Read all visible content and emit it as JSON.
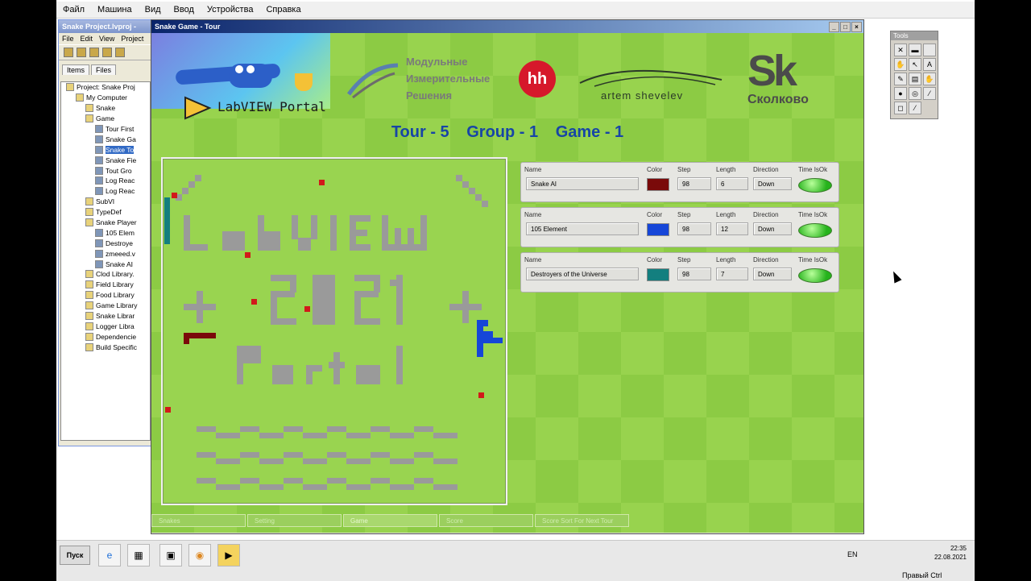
{
  "vm_menu": [
    "Файл",
    "Машина",
    "Вид",
    "Ввод",
    "Устройства",
    "Справка"
  ],
  "project": {
    "title": "Snake Project.lvproj -",
    "menu": [
      "File",
      "Edit",
      "View",
      "Project"
    ],
    "tabs": [
      "Items",
      "Files"
    ],
    "tree": [
      {
        "label": "Project: Snake Proj",
        "type": "folder",
        "indent": 0
      },
      {
        "label": "My Computer",
        "type": "folder",
        "indent": 1
      },
      {
        "label": "Snake",
        "type": "folder",
        "indent": 2
      },
      {
        "label": "Game",
        "type": "folder",
        "indent": 2
      },
      {
        "label": "Tour First",
        "type": "vi",
        "indent": 3
      },
      {
        "label": "Snake Ga",
        "type": "vi",
        "indent": 3
      },
      {
        "label": "Snake To",
        "type": "vi",
        "indent": 3,
        "selected": true
      },
      {
        "label": "Snake Fie",
        "type": "vi",
        "indent": 3
      },
      {
        "label": "Tout Gro",
        "type": "vi",
        "indent": 3
      },
      {
        "label": "Log Reac",
        "type": "vi",
        "indent": 3
      },
      {
        "label": "Log Reac",
        "type": "vi",
        "indent": 3
      },
      {
        "label": "SubVI",
        "type": "folder",
        "indent": 2
      },
      {
        "label": "TypeDef",
        "type": "folder",
        "indent": 2
      },
      {
        "label": "Snake Player",
        "type": "folder",
        "indent": 2
      },
      {
        "label": "105 Elem",
        "type": "vi",
        "indent": 3
      },
      {
        "label": "Destroye",
        "type": "vi",
        "indent": 3
      },
      {
        "label": "zmeeed.v",
        "type": "vi",
        "indent": 3
      },
      {
        "label": "Snake AI",
        "type": "vi",
        "indent": 3
      },
      {
        "label": "Clod Library.",
        "type": "folder",
        "indent": 2
      },
      {
        "label": "Field Library",
        "type": "folder",
        "indent": 2
      },
      {
        "label": "Food Library",
        "type": "folder",
        "indent": 2
      },
      {
        "label": "Game Library",
        "type": "folder",
        "indent": 2
      },
      {
        "label": "Snake Librar",
        "type": "folder",
        "indent": 2
      },
      {
        "label": "Logger Libra",
        "type": "folder",
        "indent": 2
      },
      {
        "label": "Dependencie",
        "type": "folder",
        "indent": 2
      },
      {
        "label": "Build Specific",
        "type": "folder",
        "indent": 2
      }
    ]
  },
  "main": {
    "title": "Snake Game - Tour",
    "banner": {
      "labview_portal": "LabVIEW Portal",
      "mir_lines": [
        "Модульные",
        "Измерительные",
        "Решения"
      ],
      "hh": "hh",
      "shevelev": "artem shevelev",
      "sk_big": "Sk",
      "sk_small": "Сколково"
    },
    "tour_line": [
      "Tour - 5",
      "Group - 1",
      "Game - 1"
    ],
    "labels": {
      "name": "Name",
      "color": "Color",
      "step": "Step",
      "length": "Length",
      "direction": "Direction",
      "time": "Time IsOk"
    },
    "snakes": [
      {
        "name": "Snake AI",
        "color": "#7a0a0a",
        "step": "98",
        "length": "6",
        "direction": "Down"
      },
      {
        "name": "105 Element",
        "color": "#1646d8",
        "step": "98",
        "length": "12",
        "direction": "Down"
      },
      {
        "name": "Destroyers of the Universe",
        "color": "#137f7f",
        "step": "98",
        "length": "7",
        "direction": "Down"
      }
    ],
    "tabs": [
      "Snakes",
      "Setting",
      "Game",
      "Score",
      "Score Sort For Next Tour"
    ],
    "active_tab": "Game"
  },
  "tools": {
    "title": "Tools"
  },
  "taskbar": {
    "start": "Пуск",
    "lang": "EN",
    "time": "22:35",
    "date": "22.08.2021",
    "kbd": "Правый Ctrl"
  }
}
